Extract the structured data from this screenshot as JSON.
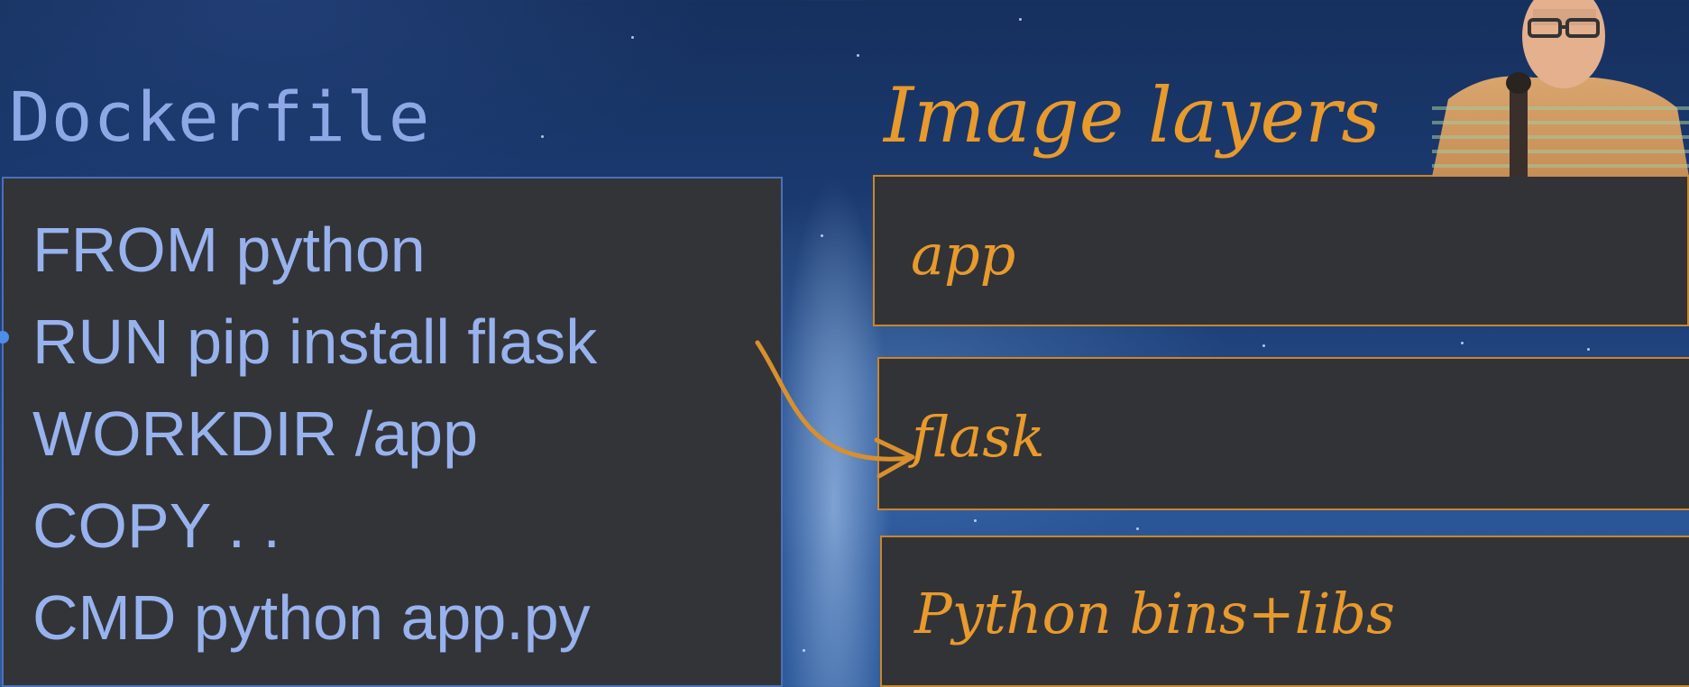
{
  "dockerfile": {
    "title": "Dockerfile",
    "lines": [
      "FROM python",
      "RUN pip install flask",
      "WORKDIR /app",
      "COPY . .",
      "CMD python app.py"
    ]
  },
  "image_layers": {
    "title": "Image layers",
    "layers": [
      "app",
      "flask",
      "Python bins+libs"
    ]
  },
  "colors": {
    "dockerfile_text": "#98b2ee",
    "layer_accent": "#e89a2c",
    "panel_bg": "#333438"
  },
  "icons": [
    "presenter-video",
    "arrow-icon"
  ]
}
